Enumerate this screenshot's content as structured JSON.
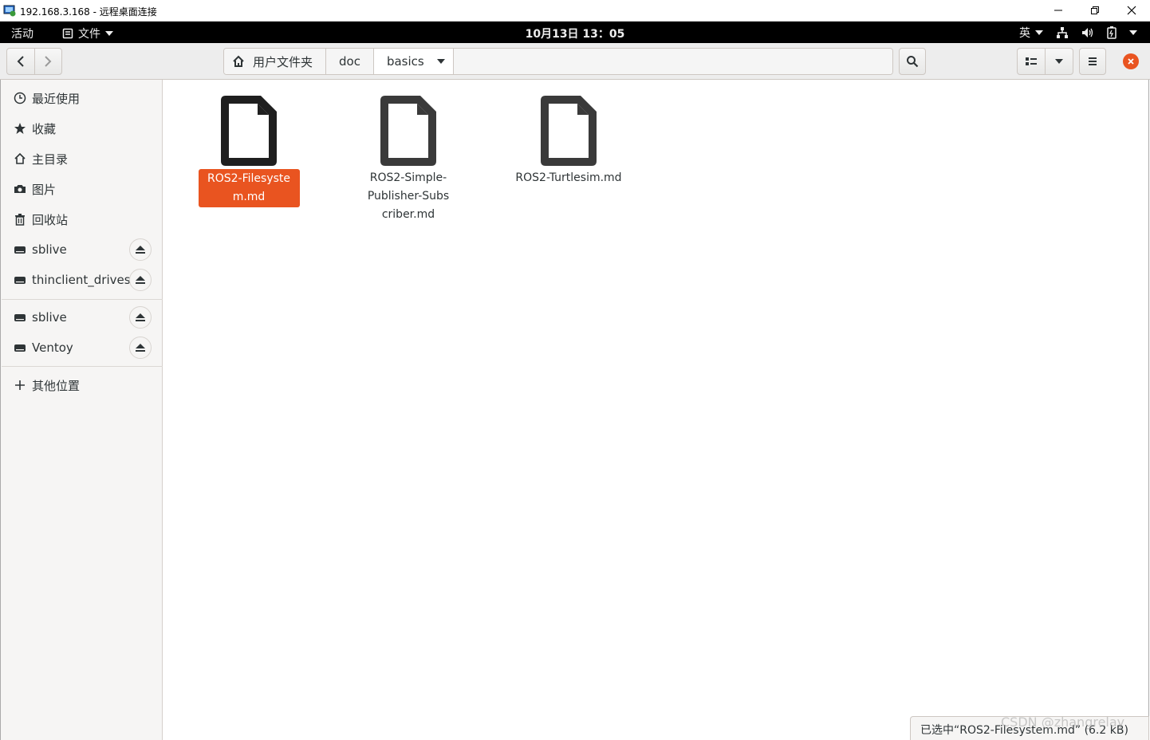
{
  "rdp": {
    "title": "192.168.3.168 - 远程桌面连接"
  },
  "gnome": {
    "activities": "活动",
    "app_menu": "文件",
    "clock": "10月13日 13：05",
    "input_method": "英"
  },
  "pathbar": {
    "crumbs": [
      "用户文件夹",
      "doc",
      "basics"
    ]
  },
  "sidebar": {
    "items": [
      {
        "label": "最近使用",
        "icon": "clock-icon"
      },
      {
        "label": "收藏",
        "icon": "star-icon"
      },
      {
        "label": "主目录",
        "icon": "home-icon"
      },
      {
        "label": "图片",
        "icon": "camera-icon"
      },
      {
        "label": "回收站",
        "icon": "trash-icon"
      }
    ],
    "mounts_1": [
      {
        "label": "sblive",
        "icon": "drive-icon"
      },
      {
        "label": "thinclient_drives",
        "icon": "drive-icon"
      }
    ],
    "mounts_2": [
      {
        "label": "sblive",
        "icon": "drive-icon"
      },
      {
        "label": "Ventoy",
        "icon": "drive-icon"
      }
    ],
    "other": "其他位置"
  },
  "files": [
    {
      "name": "ROS2-Filesystem.md",
      "selected": true
    },
    {
      "name": "ROS2-Simple-Publisher-Subscriber.md",
      "selected": false
    },
    {
      "name": "ROS2-Turtlesim.md",
      "selected": false
    }
  ],
  "status": {
    "text": "已选中“ROS2-Filesystem.md” (6.2 kB)"
  },
  "watermark": "CSDN @zhangrelay",
  "colors": {
    "accent": "#e95420",
    "close_button": "#e95420"
  }
}
